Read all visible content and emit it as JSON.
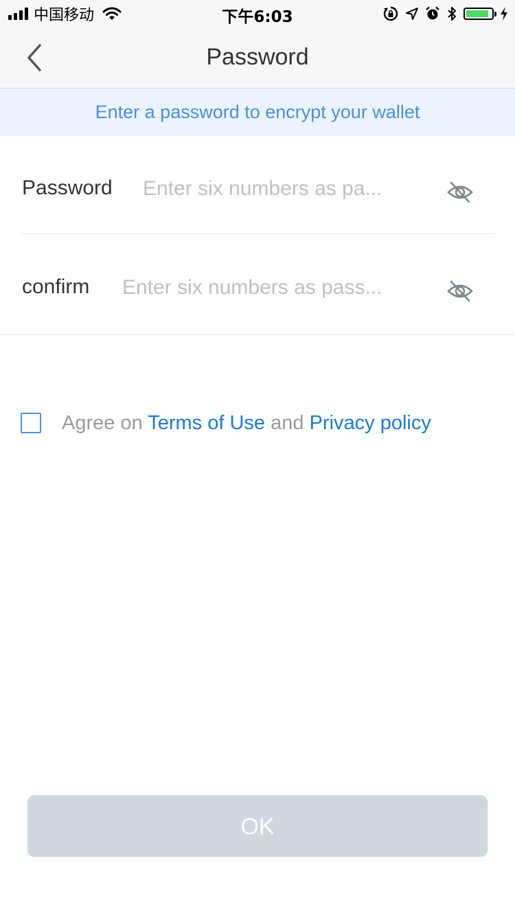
{
  "status_bar": {
    "carrier": "中国移动",
    "time": "下午6:03",
    "battery_level": 0.9,
    "battery_color": "#4cd964"
  },
  "nav": {
    "title": "Password",
    "back_icon": "chevron-left-icon"
  },
  "hint": "Enter a password to encrypt your wallet",
  "form": {
    "password": {
      "label": "Password",
      "value": "",
      "placeholder": "Enter six numbers as pa...",
      "toggle_icon": "eye-off-icon"
    },
    "confirm": {
      "label": "confirm",
      "value": "",
      "placeholder": "Enter six numbers as pass...",
      "toggle_icon": "eye-off-icon"
    }
  },
  "agreement": {
    "checked": false,
    "prefix": "Agree on",
    "terms_label": "Terms of Use",
    "and_text": "and",
    "privacy_label": "Privacy policy"
  },
  "ok_label": "OK",
  "colors": {
    "accent": "#4a90d9",
    "link": "#1a7bd6",
    "button_disabled": "#cfd8de",
    "banner_bg": "#ecf3fc"
  }
}
